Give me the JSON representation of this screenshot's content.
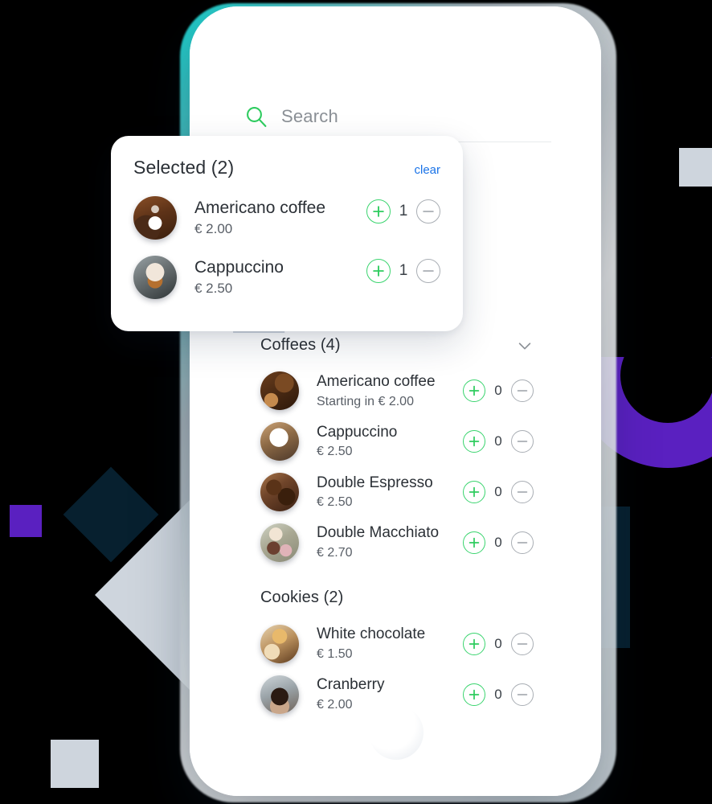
{
  "search": {
    "placeholder": "Search",
    "value": "",
    "icon": "search-icon"
  },
  "selected_card": {
    "title": "Selected (2)",
    "clear_label": "clear",
    "items": [
      {
        "name": "Americano coffee",
        "price": "€ 2.00",
        "qty": "1",
        "thumb_class": "th-americano-sel",
        "thumb_name": "americano-coffee-thumbnail"
      },
      {
        "name": "Cappuccino",
        "price": "€ 2.50",
        "qty": "1",
        "thumb_class": "th-cappuccino-sel",
        "thumb_name": "cappuccino-thumbnail"
      }
    ]
  },
  "catalogue": {
    "sections": [
      {
        "title": "Coffees (4)",
        "collapse_icon": "chevron-down-icon",
        "has_chevron": true,
        "items": [
          {
            "name": "Americano coffee",
            "price": "Starting in € 2.00",
            "qty": "0",
            "thumb_class": "th-americano",
            "thumb_name": "americano-coffee-thumbnail"
          },
          {
            "name": "Cappuccino",
            "price": "€ 2.50",
            "qty": "0",
            "thumb_class": "th-cappuccino",
            "thumb_name": "cappuccino-thumbnail"
          },
          {
            "name": "Double Espresso",
            "price": "€ 2.50",
            "qty": "0",
            "thumb_class": "th-espresso",
            "thumb_name": "double-espresso-thumbnail"
          },
          {
            "name": "Double Macchiato",
            "price": "€ 2.70",
            "qty": "0",
            "thumb_class": "th-macchiato",
            "thumb_name": "double-macchiato-thumbnail"
          }
        ]
      },
      {
        "title": "Cookies (2)",
        "collapse_icon": "",
        "has_chevron": false,
        "items": [
          {
            "name": "White chocolate",
            "price": "€ 1.50",
            "qty": "0",
            "thumb_class": "th-whitechoc",
            "thumb_name": "white-chocolate-cookie-thumbnail"
          },
          {
            "name": "Cranberry",
            "price": "€ 2.00",
            "qty": "0",
            "thumb_class": "th-cranberry",
            "thumb_name": "cranberry-cookie-thumbnail"
          }
        ]
      }
    ]
  },
  "colors": {
    "accent_green": "#3ad46e",
    "link_blue": "#1a73e8",
    "purple": "#5a20c0",
    "navy": "#07202f",
    "light_gray": "#ced5dd",
    "text_primary": "#2b3036",
    "text_secondary": "#585e66",
    "background": "#000000"
  }
}
